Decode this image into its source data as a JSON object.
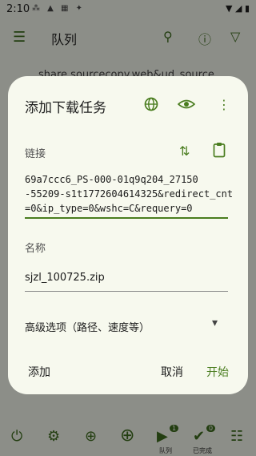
{
  "status": {
    "time": "2:10"
  },
  "appbar": {
    "title": "队列"
  },
  "background_list": {
    "item_text": "share.sourcecopy.web&ud_source"
  },
  "dialog": {
    "title": "添加下载任务",
    "link_label": "链接",
    "link_value": "69a7ccc6_PS-000-01q9q204_27150\n-55209-s1t1772604614325&redirect_cnt\n=0&ip_type=0&wshc=C&requery=0",
    "name_label": "名称",
    "name_value": "sjzl_100725.zip",
    "advanced_label": "高级选项（路径、速度等）",
    "add_label": "添加",
    "cancel_label": "取消",
    "start_label": "开始",
    "accent_color": "#4a7d1f"
  },
  "bottom_nav": {
    "queue_badge": "1",
    "queue_label": "队列",
    "done_badge": "0",
    "done_label": "已完成"
  }
}
